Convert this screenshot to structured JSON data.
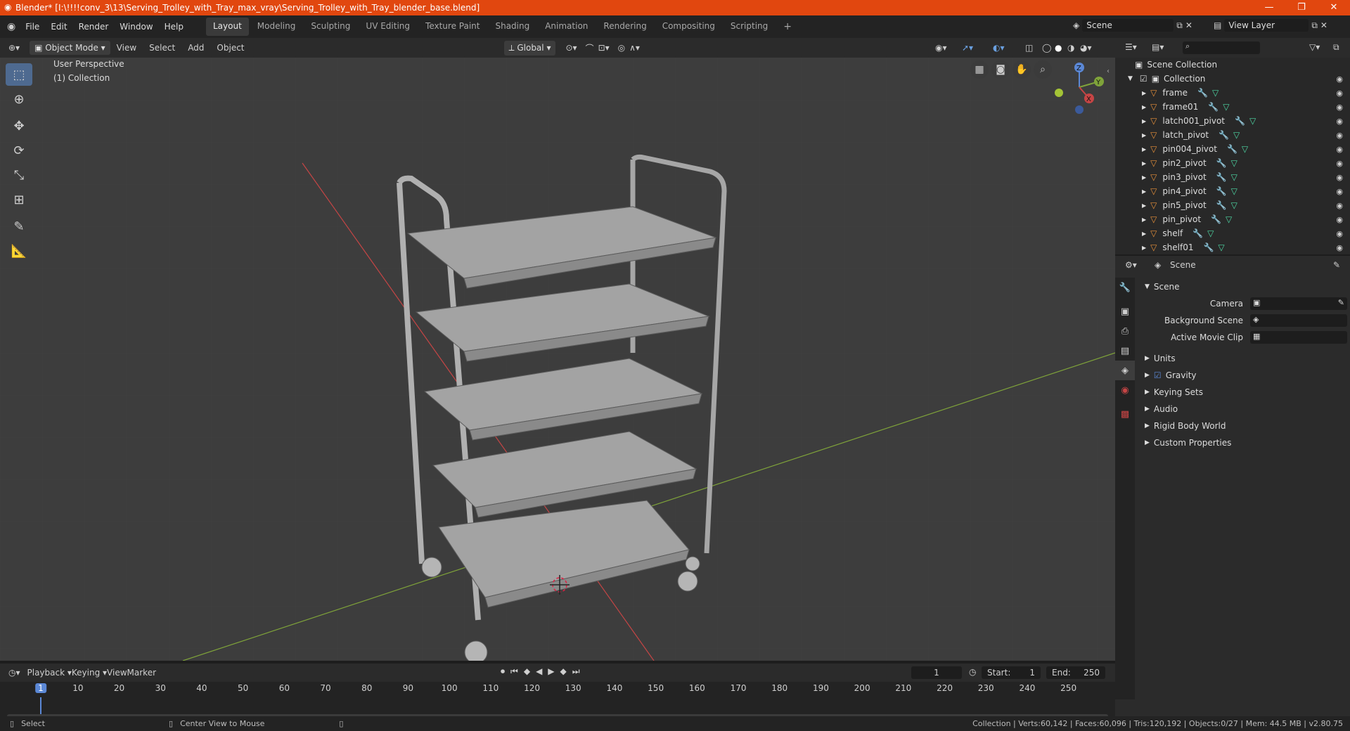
{
  "window": {
    "title": "Blender* [I:\\!!!!conv_3\\13\\Serving_Trolley_with_Tray_max_vray\\Serving_Trolley_with_Tray_blender_base.blend]"
  },
  "menu": [
    "File",
    "Edit",
    "Render",
    "Window",
    "Help"
  ],
  "workspaces": [
    "Layout",
    "Modeling",
    "Sculpting",
    "UV Editing",
    "Texture Paint",
    "Shading",
    "Animation",
    "Rendering",
    "Compositing",
    "Scripting"
  ],
  "active_workspace": "Layout",
  "scene_name": "Scene",
  "view_layer": "View Layer",
  "header3d": {
    "mode": "Object Mode",
    "menus": [
      "View",
      "Select",
      "Add",
      "Object"
    ],
    "orientation": "Global"
  },
  "viewport": {
    "perspective": "User Perspective",
    "collection": "(1) Collection"
  },
  "gizmo": {
    "x": "X",
    "y": "Y",
    "z": "Z"
  },
  "outliner": {
    "root": "Scene Collection",
    "collection": "Collection",
    "items": [
      "frame",
      "frame01",
      "latch001_pivot",
      "latch_pivot",
      "pin004_pivot",
      "pin2_pivot",
      "pin3_pivot",
      "pin4_pivot",
      "pin5_pivot",
      "pin_pivot",
      "shelf",
      "shelf01"
    ]
  },
  "properties": {
    "context": "Scene",
    "section": "Scene",
    "fields": {
      "camera": "Camera",
      "background_scene": "Background Scene",
      "active_movie_clip": "Active Movie Clip"
    },
    "panels": [
      "Units",
      "Gravity",
      "Keying Sets",
      "Audio",
      "Rigid Body World",
      "Custom Properties"
    ]
  },
  "timeline": {
    "menus": [
      "Playback",
      "Keying",
      "View",
      "Marker"
    ],
    "current_frame": "1",
    "start_label": "Start:",
    "start": "1",
    "end_label": "End:",
    "end": "250",
    "ticks": [
      "1",
      "10",
      "20",
      "30",
      "40",
      "50",
      "60",
      "70",
      "80",
      "90",
      "100",
      "110",
      "120",
      "130",
      "140",
      "150",
      "160",
      "170",
      "180",
      "190",
      "200",
      "210",
      "220",
      "230",
      "240",
      "250"
    ]
  },
  "status": {
    "select": "Select",
    "center_view": "Center View to Mouse",
    "stats": "Collection | Verts:60,142 | Faces:60,096 | Tris:120,192 | Objects:0/27 | Mem: 44.5 MB | v2.80.75"
  },
  "colors": {
    "accent": "#4e6a90",
    "titlebar": "#e1470f",
    "axis_x": "#c64545",
    "axis_y": "#7fa33a",
    "object_icon": "#e8913a",
    "mesh_icon": "#4ed9a5"
  }
}
